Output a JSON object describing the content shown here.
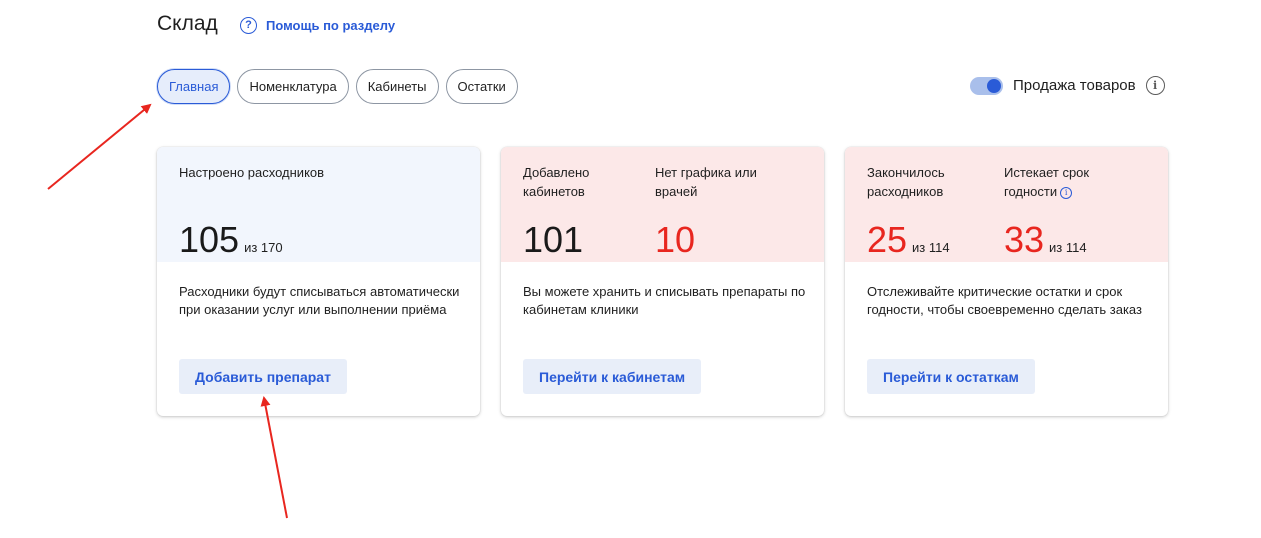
{
  "header": {
    "title": "Склад",
    "help_label": "Помощь по разделу",
    "help_icon": "?"
  },
  "tabs": [
    {
      "label": "Главная",
      "active": true
    },
    {
      "label": "Номенклатура",
      "active": false
    },
    {
      "label": "Кабинеты",
      "active": false
    },
    {
      "label": "Остатки",
      "active": false
    }
  ],
  "sales_toggle": {
    "label": "Продажа товаров",
    "enabled": true,
    "info_icon": "i"
  },
  "cards": {
    "consumables": {
      "stat_label": "Настроено расходников",
      "value": "105",
      "of": "из 170",
      "description": "Расходники будут списываться автоматически при оказании услуг или выполнении приёма",
      "button": "Добавить препарат"
    },
    "cabinets": {
      "stat1_label": "Добавлено кабинетов",
      "stat1_value": "101",
      "stat2_label": "Нет графика или врачей",
      "stat2_value": "10",
      "description": "Вы можете хранить и списывать препараты по кабинетам клиники",
      "button": "Перейти к кабинетам"
    },
    "stock": {
      "stat1_label": "Закончилось расходников",
      "stat1_value": "25",
      "stat1_of": "из 114",
      "stat2_label": "Истекает срок годности",
      "stat2_info_icon": "i",
      "stat2_value": "33",
      "stat2_of": "из 114",
      "description": "Отслеживайте критические остатки и срок годности, чтобы своевременно сделать заказ",
      "button": "Перейти к остаткам"
    }
  },
  "colors": {
    "accent": "#2a5bd7",
    "alert_red": "#e8261f",
    "card_blue_bg": "#f2f6fd",
    "card_pink_bg": "#fce8e8",
    "annotation_arrow": "#e8261f"
  }
}
